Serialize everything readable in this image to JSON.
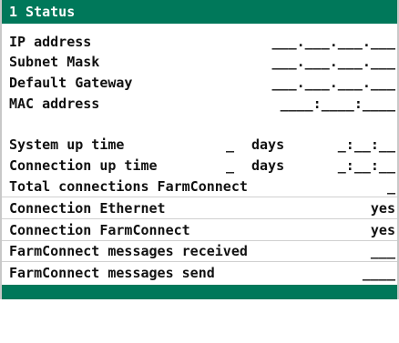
{
  "title": "1 Status",
  "network": {
    "ip_label": "IP address",
    "ip_value": "___.___.___.___",
    "subnet_label": "Subnet Mask",
    "subnet_value": "___.___.___.___",
    "gateway_label": "Default Gateway",
    "gateway_value": "___.___.___.___",
    "mac_label": "MAC address",
    "mac_value": "____:____:____"
  },
  "uptime": {
    "system_label": "System up time",
    "system_days": "_",
    "system_unit": "days",
    "system_time": "_:__:__",
    "connection_label": "Connection up time",
    "connection_days": "_",
    "connection_unit": "days",
    "connection_time": "_:__:__"
  },
  "stats": {
    "total_label": "Total connections FarmConnect",
    "total_value": "_",
    "ethernet_label": "Connection Ethernet",
    "ethernet_value": "yes",
    "farmconnect_label": "Connection FarmConnect",
    "farmconnect_value": "yes",
    "received_label": "FarmConnect messages received",
    "received_value": "___",
    "send_label": "FarmConnect messages send",
    "send_value": "____"
  },
  "colors": {
    "accent": "#00785a",
    "text": "#111111",
    "background": "#ffffff"
  }
}
